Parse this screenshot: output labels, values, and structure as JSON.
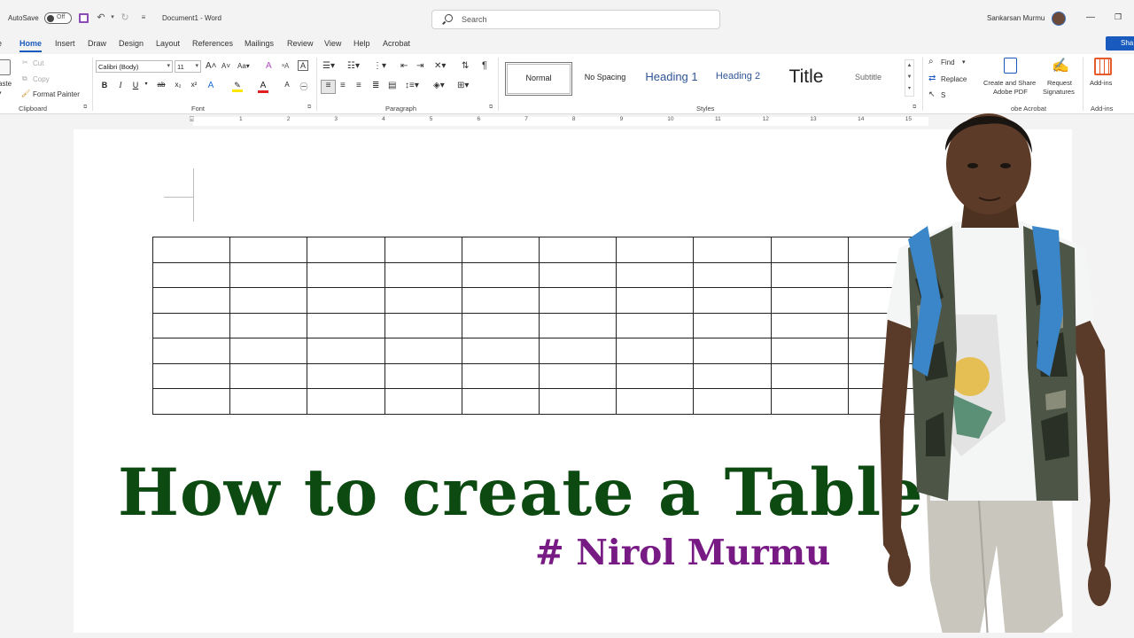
{
  "titlebar": {
    "autosave_label": "AutoSave",
    "autosave_state": "Off",
    "doc_title": "Document1 - Word",
    "search_placeholder": "Search",
    "user_name": "Sankarsan Murmu"
  },
  "tabs": [
    {
      "label": "Home",
      "active": true
    },
    {
      "label": "Insert"
    },
    {
      "label": "Draw"
    },
    {
      "label": "Design"
    },
    {
      "label": "Layout"
    },
    {
      "label": "References"
    },
    {
      "label": "Mailings"
    },
    {
      "label": "Review"
    },
    {
      "label": "View"
    },
    {
      "label": "Help"
    },
    {
      "label": "Acrobat"
    }
  ],
  "share_label": "Sha",
  "clipboard": {
    "paste": "aste",
    "cut": "Cut",
    "copy": "Copy",
    "format_painter": "Format Painter",
    "group_label": "Clipboard"
  },
  "font": {
    "name": "Calibri (Body)",
    "size": "11",
    "group_label": "Font",
    "bold": "B",
    "italic": "I",
    "underline": "U"
  },
  "paragraph": {
    "group_label": "Paragraph"
  },
  "styles": {
    "items": [
      "Normal",
      "No Spacing",
      "Heading 1",
      "Heading 2",
      "Title",
      "Subtitle"
    ],
    "group_label": "Styles"
  },
  "editing": {
    "find": "Find",
    "replace": "Replace",
    "select": "S"
  },
  "acrobat": {
    "create_share_1": "Create and Share",
    "create_share_2": "Adobe PDF",
    "request_1": "Request",
    "request_2": "Signatures",
    "group_label": "obe Acrobat"
  },
  "addins": {
    "label": "Add-ins",
    "group_label": "Add-ins"
  },
  "ruler_numbers": [
    "1",
    "2",
    "3",
    "4",
    "5",
    "6",
    "7",
    "8",
    "9",
    "10",
    "11",
    "12",
    "13",
    "14",
    "15"
  ],
  "table": {
    "rows": 7,
    "cols": 10
  },
  "overlay": {
    "headline": "How to create a Table",
    "author": "# Nirol Murmu"
  },
  "colors": {
    "accent": "#185abd",
    "headline": "#0d4a12",
    "author": "#781a84"
  }
}
